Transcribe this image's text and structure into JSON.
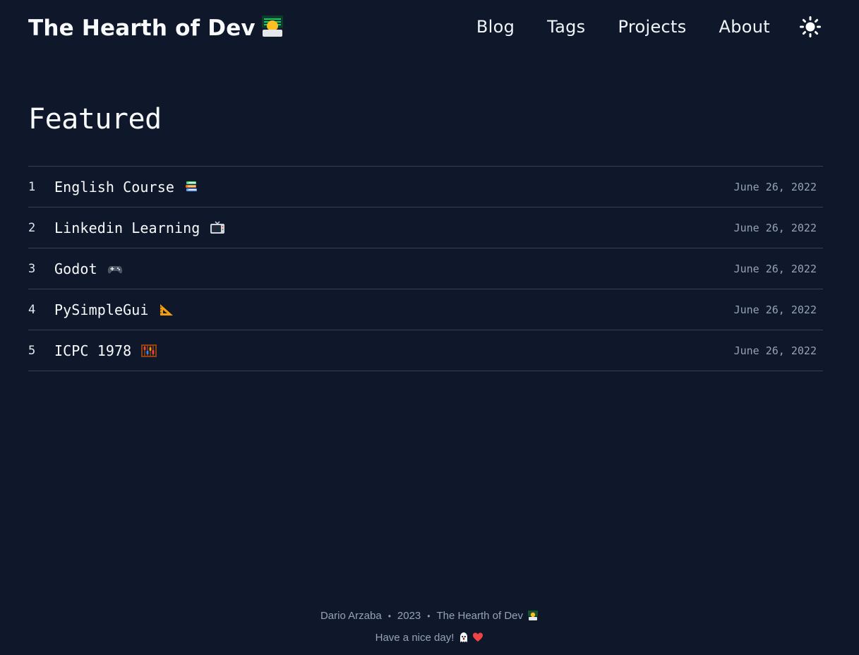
{
  "header": {
    "site_title": "The Hearth of Dev",
    "logo_icon": "technologist-emoji",
    "nav": [
      {
        "label": "Blog"
      },
      {
        "label": "Tags"
      },
      {
        "label": "Projects"
      },
      {
        "label": "About"
      }
    ],
    "theme_icon": "sun-icon"
  },
  "main": {
    "section_title": "Featured",
    "posts": [
      {
        "num": "1",
        "title": "English Course",
        "icon": "books-emoji",
        "date": "June 26, 2022"
      },
      {
        "num": "2",
        "title": "Linkedin Learning",
        "icon": "television-emoji",
        "date": "June 26, 2022"
      },
      {
        "num": "3",
        "title": "Godot",
        "icon": "video-game-emoji",
        "date": "June 26, 2022"
      },
      {
        "num": "4",
        "title": "PySimpleGui",
        "icon": "triangular-ruler-emoji",
        "date": "June 26, 2022"
      },
      {
        "num": "5",
        "title": "ICPC 1978",
        "icon": "abacus-emoji",
        "date": "June 26, 2022"
      }
    ]
  },
  "footer": {
    "author": "Dario Arzaba",
    "year": "2023",
    "site": "The Hearth of Dev",
    "tagline": "Have a nice day!"
  },
  "colors": {
    "background": "#0f172a",
    "text": "#f1f5f9",
    "muted": "#94a3b8",
    "divider": "#334155"
  }
}
